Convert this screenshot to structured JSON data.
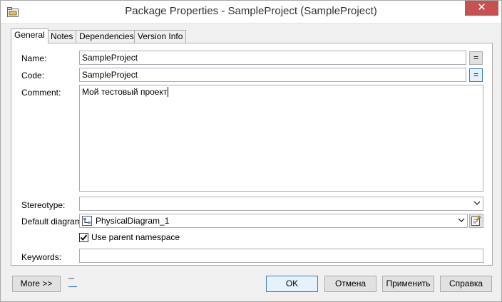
{
  "window": {
    "title": "Package Properties - SampleProject (SampleProject)",
    "close_label": "✕",
    "close_color": "#c75050"
  },
  "tabs": [
    {
      "label": "General",
      "active": true
    },
    {
      "label": "Notes"
    },
    {
      "label": "Dependencies"
    },
    {
      "label": "Version Info"
    }
  ],
  "form": {
    "name": {
      "label": "Name:",
      "value": "SampleProject",
      "button": "="
    },
    "code": {
      "label": "Code:",
      "value": "SampleProject",
      "button": "="
    },
    "comment": {
      "label": "Comment:",
      "value": "Мой тестовый проект"
    },
    "stereotype": {
      "label": "Stereotype:",
      "value": ""
    },
    "default_diagram": {
      "label": "Default diagram:",
      "value": "PhysicalDiagram_1"
    },
    "use_parent_namespace": {
      "label": "Use parent namespace",
      "checked": true
    },
    "keywords": {
      "label": "Keywords:",
      "value": ""
    }
  },
  "footer": {
    "more": "More >>",
    "ok": "OK",
    "cancel": "Отмена",
    "apply": "Применить",
    "help": "Справка"
  },
  "icons": {
    "title": "package-icon",
    "diagram": "physical-diagram-icon",
    "properties": "properties-icon",
    "small": "note-icon"
  }
}
